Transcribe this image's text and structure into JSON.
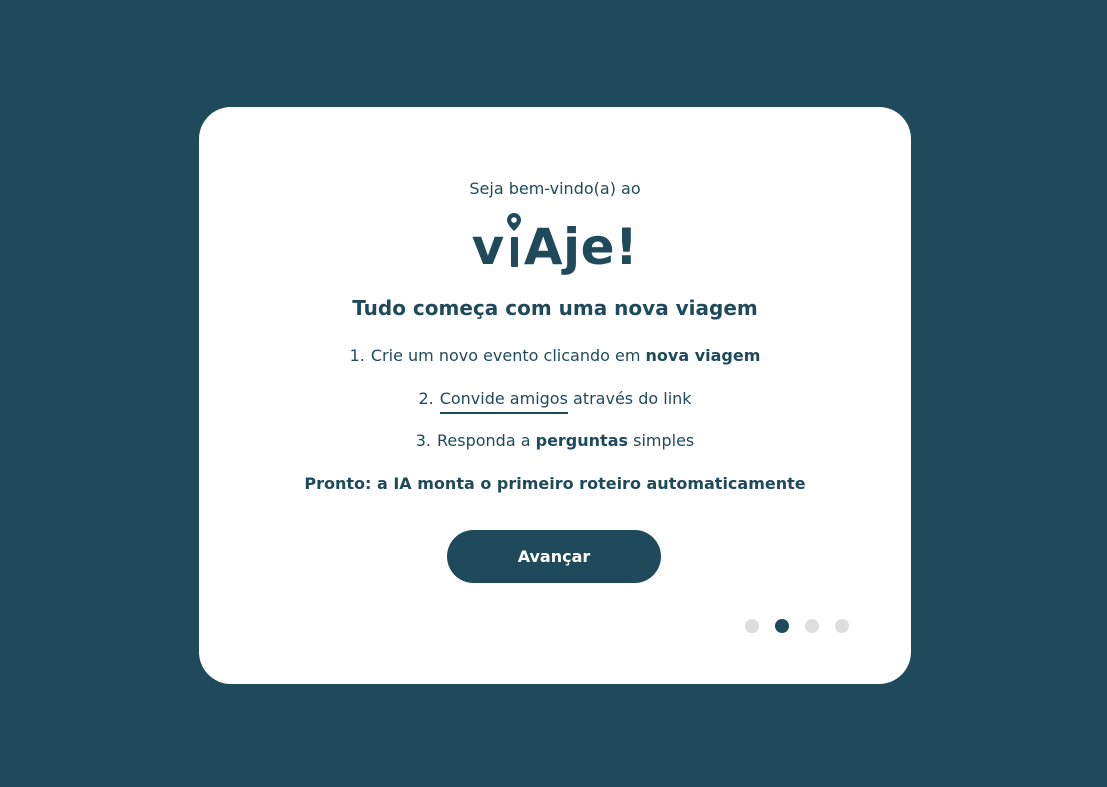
{
  "welcome": "Seja bem-vindo(a) ao",
  "logo": {
    "part1": "v",
    "part2": "I",
    "part3": "Aje!"
  },
  "headline": "Tudo começa com uma nova viagem",
  "steps": [
    {
      "num": "1.",
      "text": "Crie um novo evento clicando em ",
      "bold": "nova viagem"
    },
    {
      "num": "2.",
      "link": "Convide amigos",
      "text": "através do link"
    },
    {
      "num": "3.",
      "text": "Responda a ",
      "bold": "perguntas",
      "text_after": " simples"
    }
  ],
  "ready": "Pronto: a IA monta o primeiro roteiro automaticamente",
  "button_label": "Avançar",
  "pagination": {
    "total": 4,
    "active_index": 1
  },
  "colors": {
    "background": "#1e4a5c",
    "card": "#ffffff",
    "accent": "#1e4a5c",
    "dot_inactive": "#dedede"
  },
  "icons": {
    "logo_pin": "location-pin-icon"
  }
}
